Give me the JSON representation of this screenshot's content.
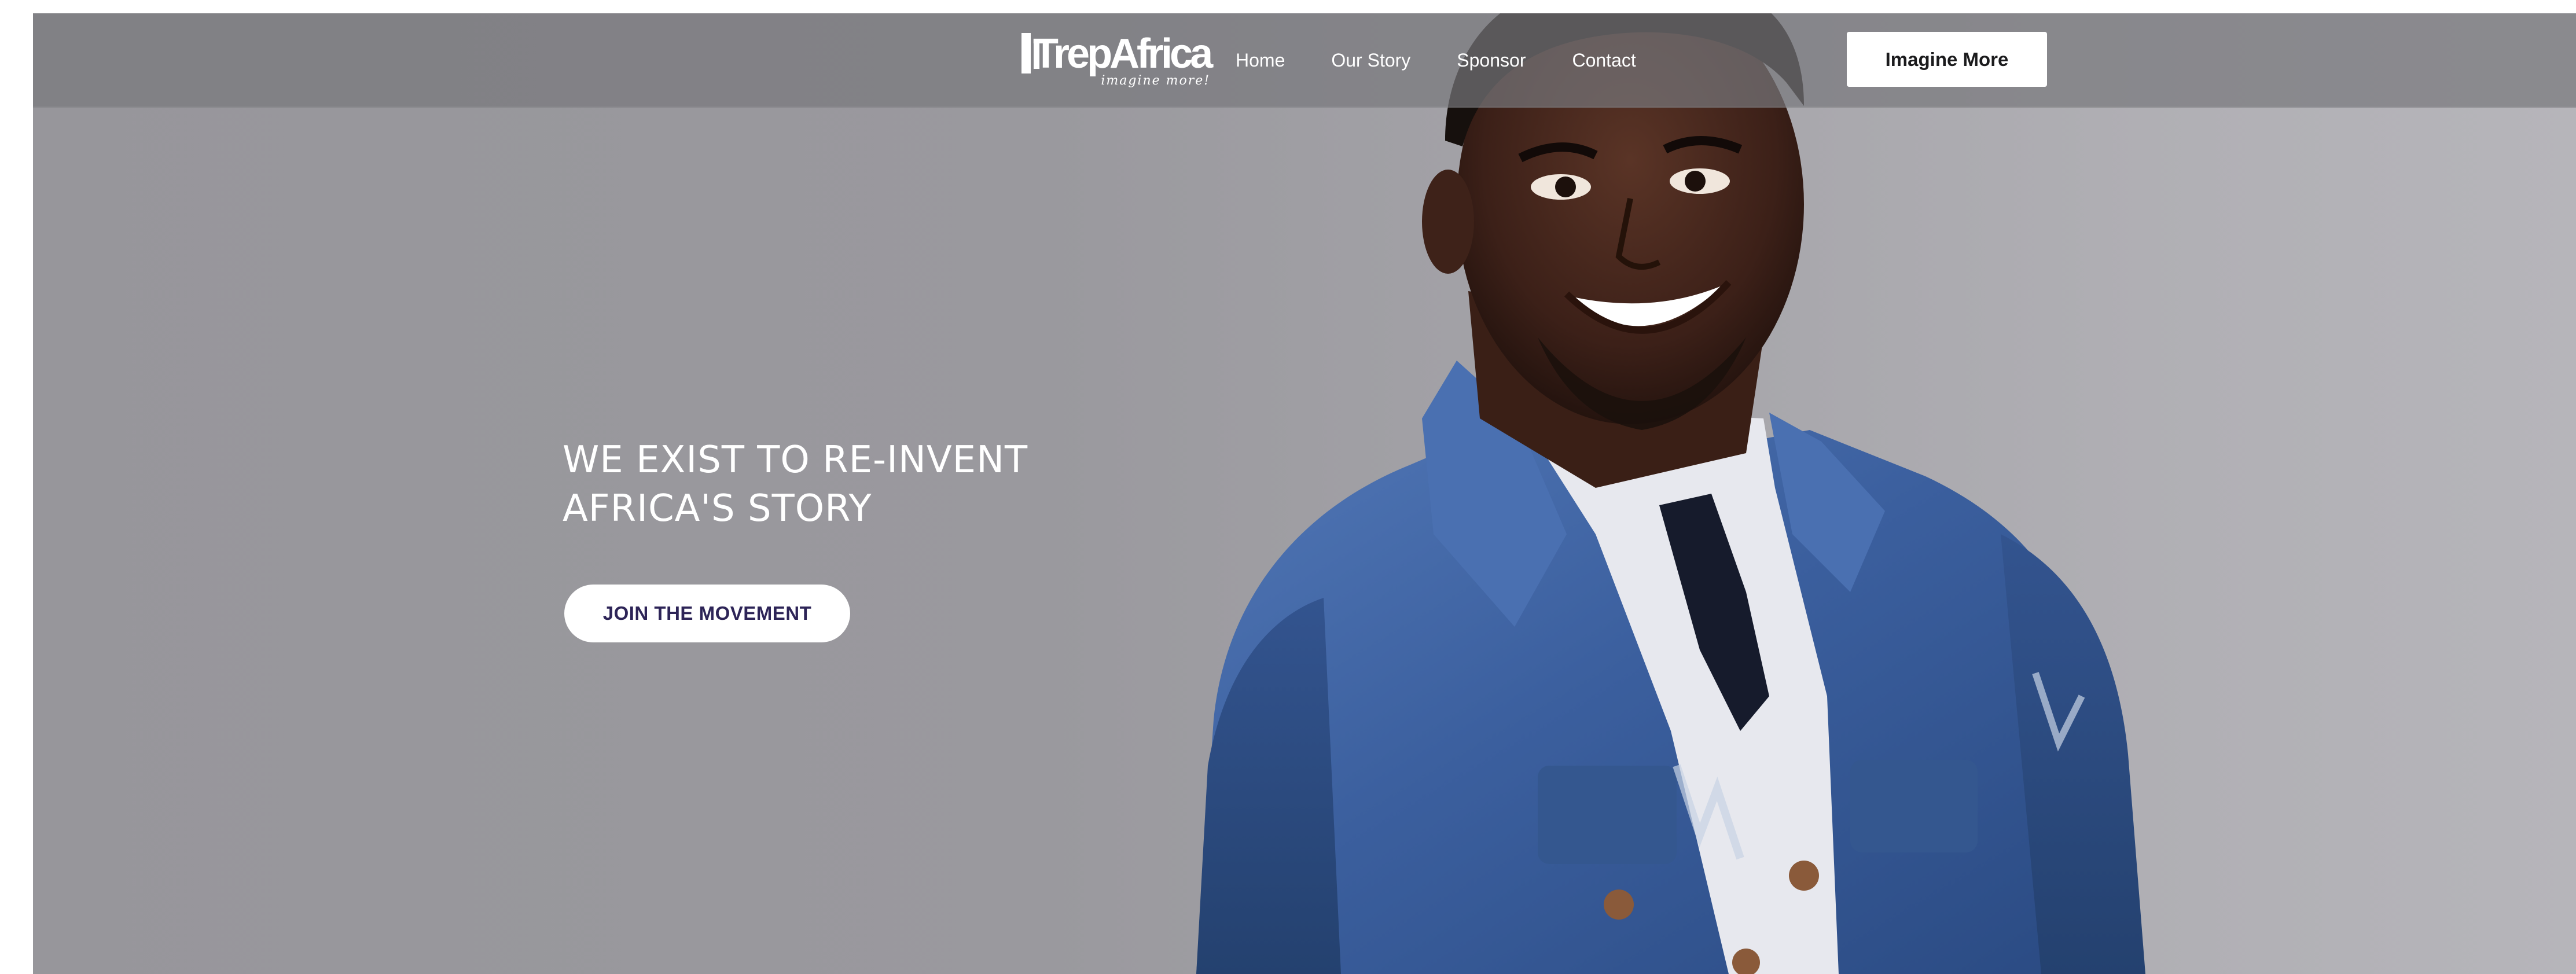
{
  "header": {
    "logo": {
      "wordmark": "TrepAfrica",
      "tagline": "imagine more!"
    },
    "nav": [
      {
        "label": "Home"
      },
      {
        "label": "Our Story"
      },
      {
        "label": "Sponsor"
      },
      {
        "label": "Contact"
      }
    ],
    "cta_label": "Imagine More"
  },
  "hero": {
    "headline_line1": "WE EXIST TO RE-INVENT",
    "headline_line2": "AFRICA'S STORY",
    "button_label": "JOIN THE MOVEMENT",
    "image_description": "smiling-man-denim-jacket"
  },
  "colors": {
    "header_overlay": "#78777c",
    "hero_background": "#9a999e",
    "button_text_dark": "#2d2457",
    "denim": "#3d62a3"
  }
}
